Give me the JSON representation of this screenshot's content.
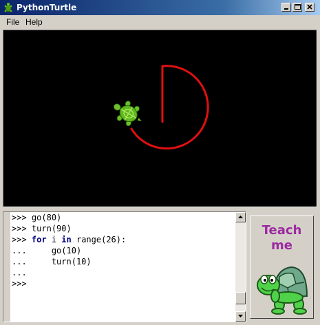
{
  "window": {
    "title": "PythonTurtle"
  },
  "menu": {
    "items": [
      {
        "label": "File"
      },
      {
        "label": "Help"
      }
    ]
  },
  "canvas": {
    "background": "#000000",
    "pen_color": "#e01010",
    "turtle_color": "#5fb81e"
  },
  "shell": {
    "lines": [
      {
        "prompt": ">>>",
        "code": "go(80)"
      },
      {
        "prompt": ">>>",
        "code": "turn(90)"
      },
      {
        "prompt": ">>>",
        "keyword1": "for",
        "mid": " i ",
        "keyword2": "in",
        "rest": " range(26):"
      },
      {
        "prompt": "...",
        "code": "    go(10)"
      },
      {
        "prompt": "...",
        "code": "    turn(10)"
      },
      {
        "prompt": "...",
        "code": ""
      },
      {
        "prompt": ">>>",
        "code": ""
      }
    ],
    "keyword_color": "#00007f"
  },
  "teach_button": {
    "label_line1": "Teach",
    "label_line2": "me",
    "label_color": "#9b2aa0"
  }
}
